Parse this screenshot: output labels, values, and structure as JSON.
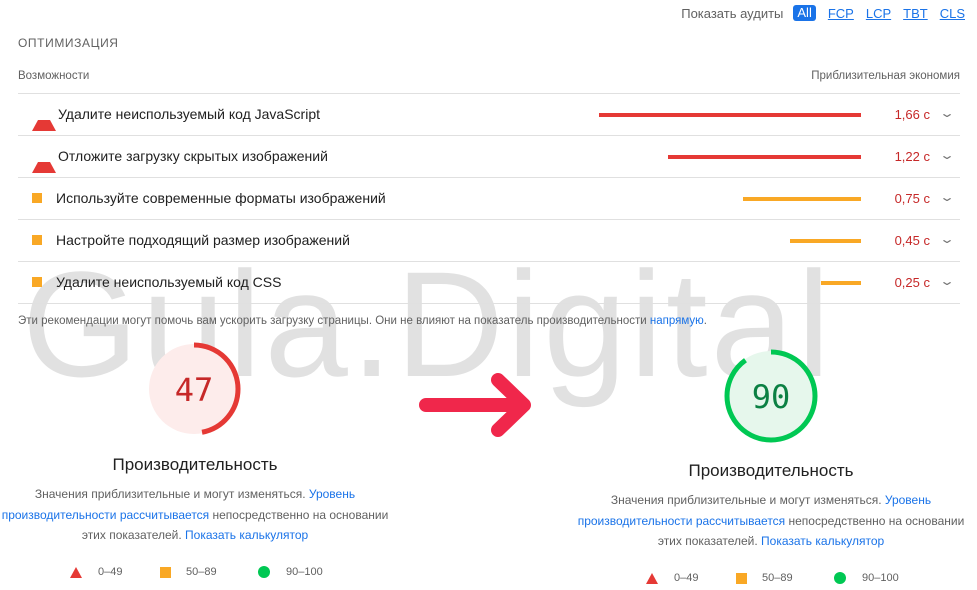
{
  "filter": {
    "label": "Показать аудиты",
    "chips": [
      "All",
      "FCP",
      "LCP",
      "TBT",
      "CLS"
    ]
  },
  "section_title": "ОПТИМИЗАЦИЯ",
  "columns": {
    "left": "Возможности",
    "right": "Приблизительная экономия"
  },
  "audits": [
    {
      "title": "Удалите неиспользуемый код JavaScript",
      "value": "1,66 с",
      "severity": "fail",
      "savings_fraction": 1.0
    },
    {
      "title": "Отложите загрузку скрытых изображений",
      "value": "1,22 с",
      "severity": "fail",
      "savings_fraction": 0.735
    },
    {
      "title": "Используйте современные форматы изображений",
      "value": "0,75 с",
      "severity": "average",
      "savings_fraction": 0.452
    },
    {
      "title": "Настройте подходящий размер изображений",
      "value": "0,45 с",
      "severity": "average",
      "savings_fraction": 0.271
    },
    {
      "title": "Удалите неиспользуемый код CSS",
      "value": "0,25 с",
      "severity": "average",
      "savings_fraction": 0.151
    }
  ],
  "note": {
    "text": "Эти рекомендации могут помочь вам ускорить загрузку страницы. Они не влияют на показатель производительности ",
    "link": "напрямую",
    "end": "."
  },
  "watermark": "Gula.Digital",
  "before": {
    "score": "47",
    "score_fraction": 0.47,
    "title": "Производительность",
    "desc_1": "Значения приблизительные и могут изменяться. ",
    "desc_link_1": "Уровень производительности рассчитывается",
    "desc_2": " непосредственно на основании этих показателей. ",
    "desc_link_2": "Показать калькулятор"
  },
  "after": {
    "score": "90",
    "score_fraction": 0.9,
    "title": "Производительность",
    "desc_1": "Значения приблизительные и могут изменяться. ",
    "desc_link_1": "Уровень производительности рассчитывается",
    "desc_2": " непосредственно на основании этих показателей. ",
    "desc_link_2": "Показать калькулятор"
  },
  "legend": {
    "fail": "0–49",
    "average": "50–89",
    "pass": "90–100"
  },
  "colors": {
    "fail": "#e53935",
    "fail_text": "#c62828",
    "average": "#f9a825",
    "pass": "#00c853",
    "pass_text": "#0b8043",
    "link": "#1a73e8",
    "arrow": "#f0274b"
  }
}
